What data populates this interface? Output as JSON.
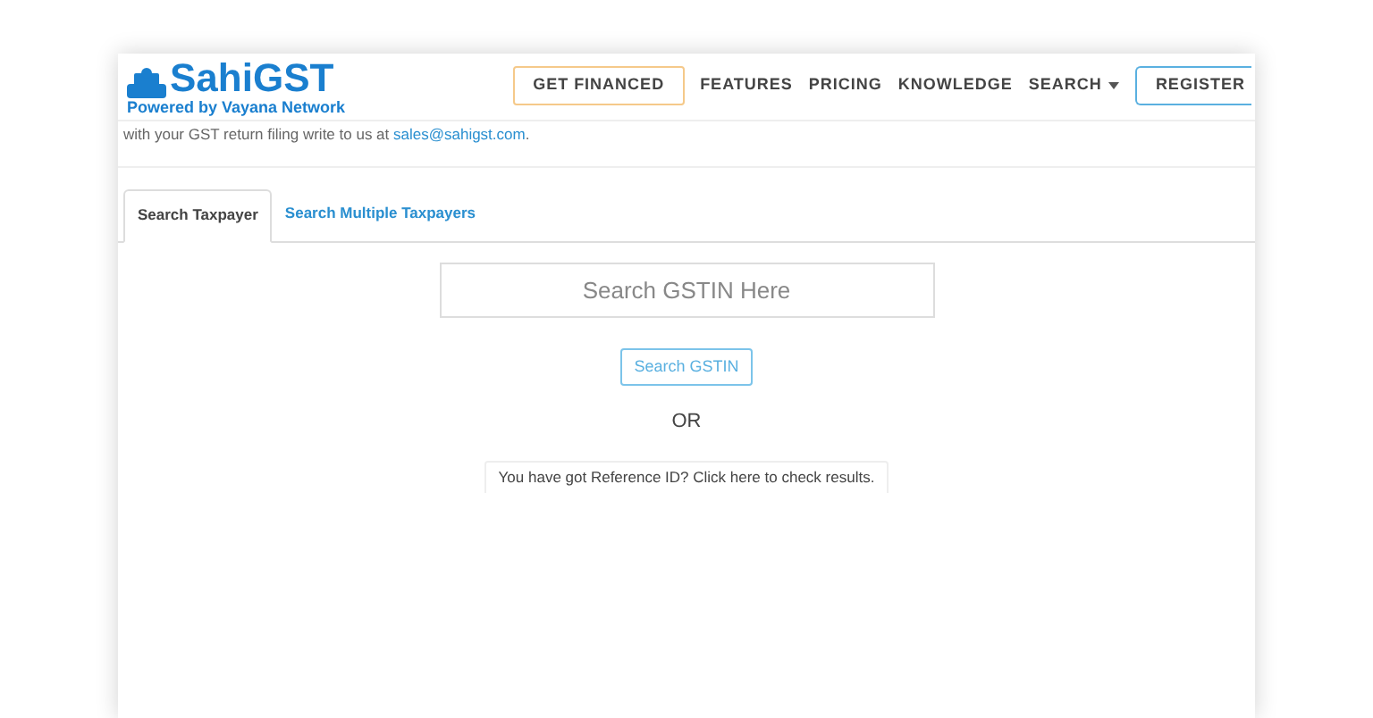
{
  "logo": {
    "name": "SahiGST",
    "tagline": "Powered by Vayana Network"
  },
  "nav": [
    {
      "label": "GET FINANCED",
      "kind": "highlight"
    },
    {
      "label": "FEATURES",
      "kind": "link"
    },
    {
      "label": "PRICING",
      "kind": "link"
    },
    {
      "label": "KNOWLEDGE",
      "kind": "link"
    },
    {
      "label": "SEARCH",
      "kind": "dropdown"
    },
    {
      "label": "REGISTER",
      "kind": "outline"
    }
  ],
  "notice": {
    "text": "with your GST return filing write to us at ",
    "link": "sales@sahigst.com",
    "end": "."
  },
  "tabs": [
    {
      "label": "Search Taxpayer",
      "selected": true
    },
    {
      "label": "Search Multiple Taxpayers",
      "selected": false
    }
  ],
  "search": {
    "placeholder": "Search GSTIN Here"
  },
  "search_button": "Search GSTIN",
  "separator": "OR",
  "reference_link": "You have got Reference ID? Click here to check results."
}
